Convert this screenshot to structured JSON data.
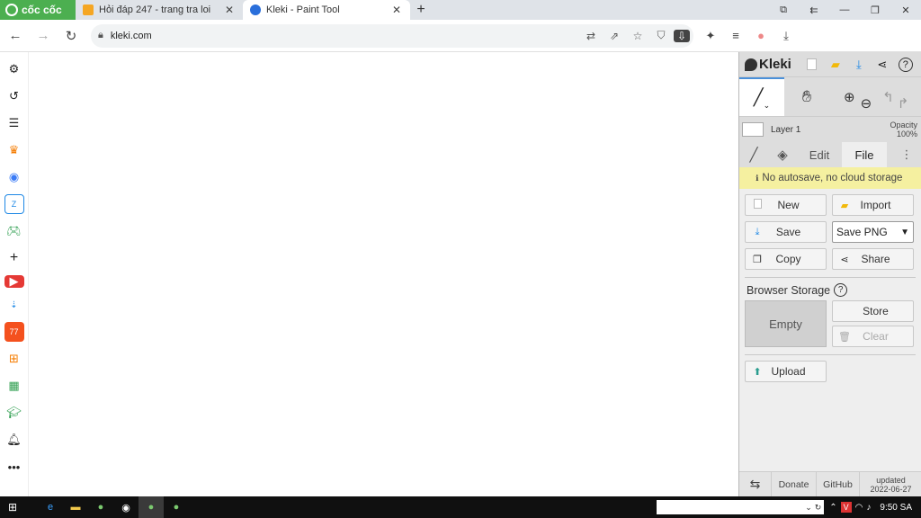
{
  "browser": {
    "brand": "cốc cốc",
    "tabs": [
      {
        "title": "Hỏi đáp 247 - trang tra loi",
        "favicon_color": "#f5a623",
        "active": false
      },
      {
        "title": "Kleki - Paint Tool",
        "favicon_color": "#2a6fdb",
        "active": true
      }
    ],
    "url": "kleki.com"
  },
  "kleki": {
    "logo": "Kleki",
    "layer": {
      "name": "Layer 1",
      "opacity_label": "Opacity",
      "opacity_value": "100%"
    },
    "tabs": {
      "edit": "Edit",
      "file": "File"
    },
    "notice": "No autosave, no cloud storage",
    "buttons": {
      "new": "New",
      "import": "Import",
      "save": "Save",
      "copy": "Copy",
      "share": "Share",
      "store": "Store",
      "clear": "Clear",
      "upload": "Upload"
    },
    "format_select": "Save PNG",
    "browser_storage": {
      "title": "Browser Storage",
      "empty_label": "Empty"
    },
    "footer": {
      "donate": "Donate",
      "github": "GitHub",
      "updated_label": "updated",
      "updated_date": "2022-06-27"
    }
  },
  "taskbar": {
    "clock": "9:50 SA"
  },
  "colors": {
    "brand_green": "#4caf50",
    "kleki_accent": "#4a90d9",
    "notice_yellow": "#f5f0a0"
  }
}
